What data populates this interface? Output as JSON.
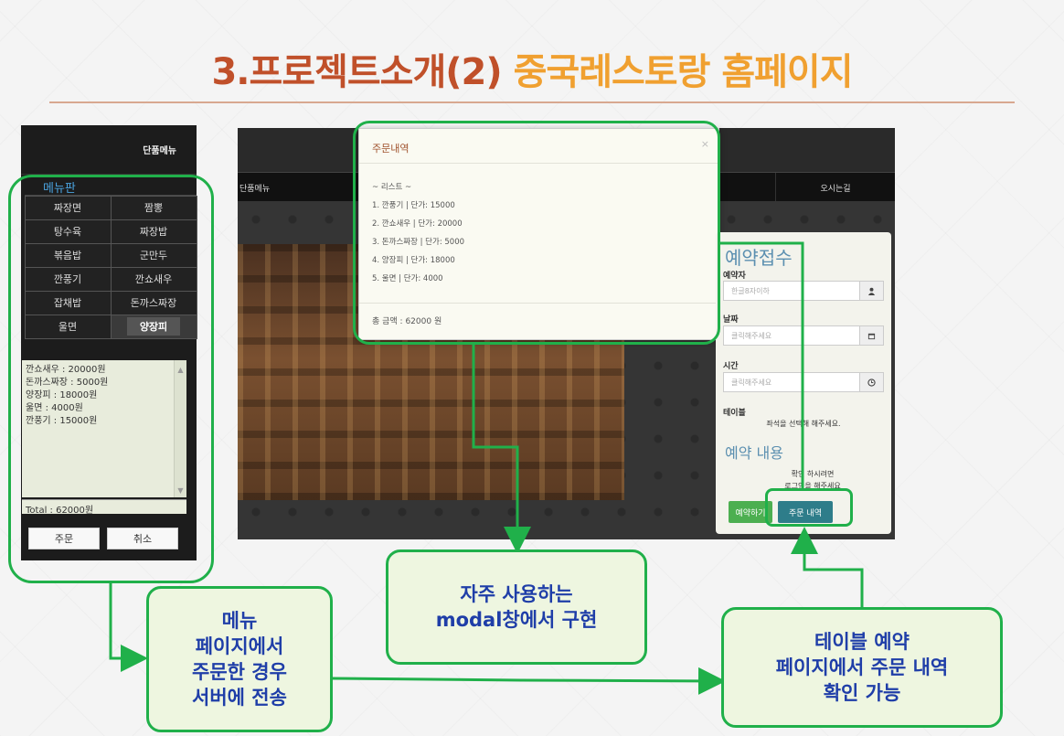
{
  "slide": {
    "title_part1": "3.프로젝트소개(2)",
    "title_part2": "중국레스토랑 홈페이지"
  },
  "menu_panel": {
    "header": "단품메뉴",
    "board_title": "메뉴판",
    "items": [
      "짜장면",
      "짬뽕",
      "탕수육",
      "짜장밥",
      "볶음밥",
      "군만두",
      "깐풍기",
      "깐쇼새우",
      "잡채밥",
      "돈까스짜장",
      "울면",
      "양장피"
    ],
    "active_item": "양장피",
    "order_lines": [
      "깐쇼새우 : 20000원",
      "돈까스짜장 : 5000원",
      "양장피 : 18000원",
      "울면 : 4000원",
      "깐풍기 : 15000원"
    ],
    "total": "Total : 62000원",
    "order_button": "주문",
    "cancel_button": "취소"
  },
  "site": {
    "nav_left": "단품메뉴",
    "nav_right": "오시는길"
  },
  "modal": {
    "title": "주문내역",
    "close": "×",
    "list_header": "~ 리스트 ~",
    "items": [
      "1. 깐풍기 | 단가: 15000",
      "2. 깐쇼새우 | 단가: 20000",
      "3. 돈까스짜장 | 단가: 5000",
      "4. 양장피 | 단가: 18000",
      "5. 울면 | 단가: 4000"
    ],
    "total": "총 금액 : 62000 원"
  },
  "reservation": {
    "title": "예약접수",
    "name_label": "예약자",
    "name_placeholder": "한글8자이하",
    "date_label": "날짜",
    "date_placeholder": "클릭해주세요",
    "time_label": "시간",
    "time_placeholder": "클릭해주세요",
    "table_label": "테이블",
    "table_note": "좌석을 선택해 해주세요.",
    "content_title": "예약 내용",
    "content_note1": "확인 하시려면",
    "content_note2": "로그인을 해주세요",
    "reserve_button": "예약하기",
    "order_history_button": "주문 내역"
  },
  "callouts": {
    "menu": [
      "메뉴",
      "페이지에서",
      "주문한 경우",
      "서버에 전송"
    ],
    "modal": [
      "자주 사용하는",
      "modal창에서 구현"
    ],
    "reservation": [
      "테이블 예약",
      "페이지에서 주문 내역",
      "확인 가능"
    ]
  },
  "colors": {
    "title_red": "#c0502a",
    "title_orange": "#f0a030",
    "highlight_green": "#20b04a",
    "callout_text": "#1f3ea8",
    "callout_bg": "#eef6e0"
  }
}
